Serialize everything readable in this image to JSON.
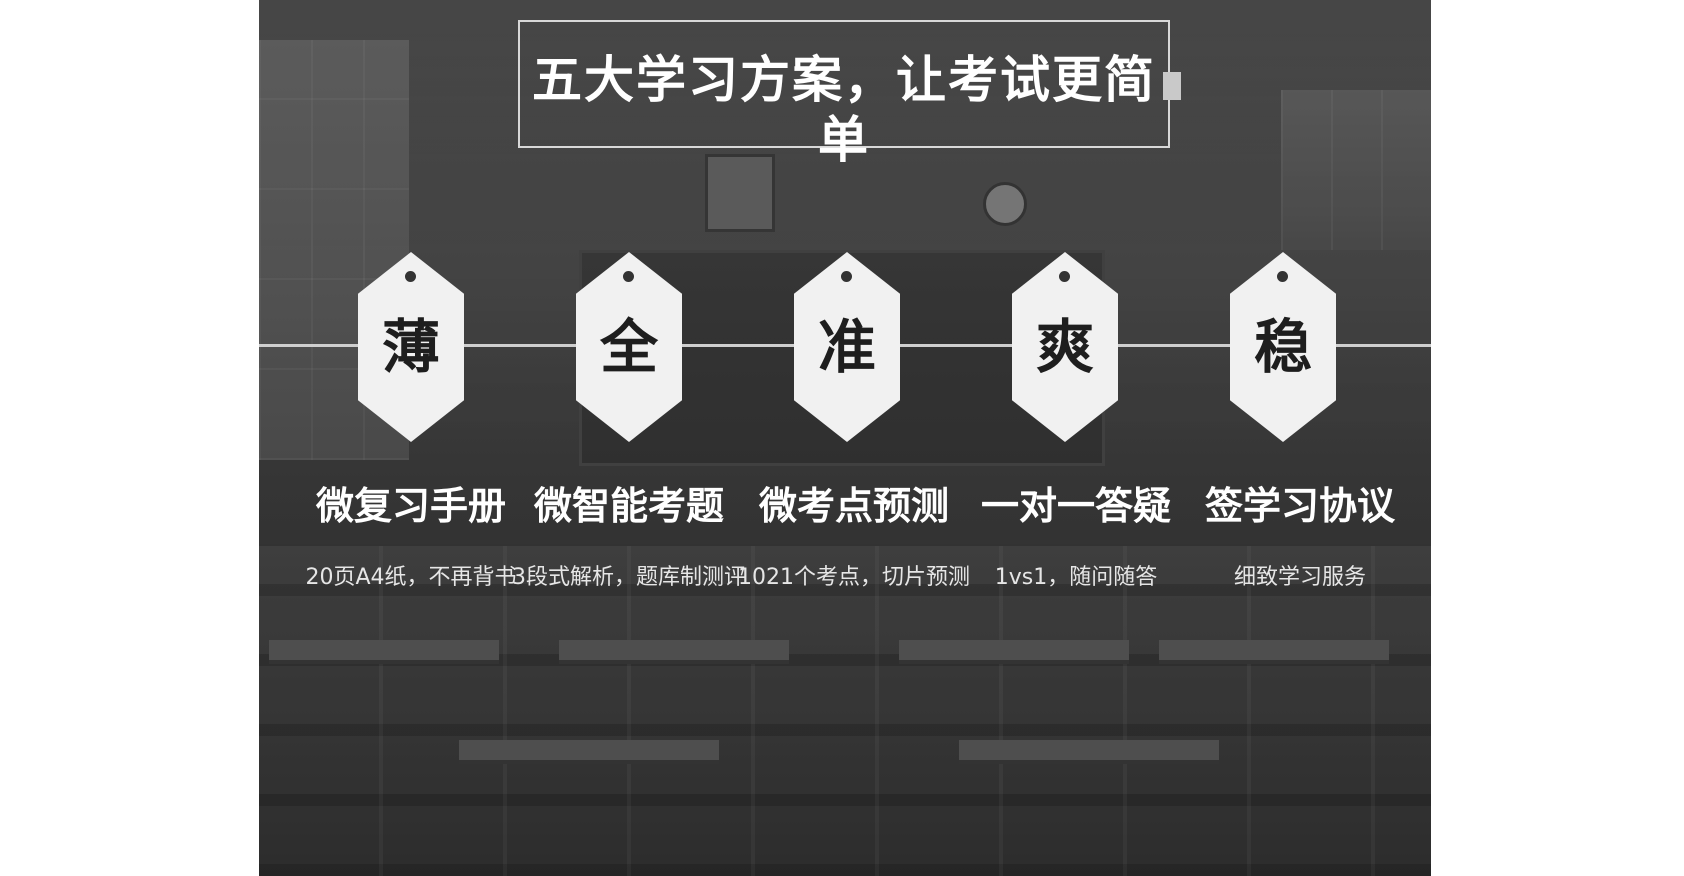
{
  "title": "五大学习方案，让考试更简单",
  "items": [
    {
      "char": "薄",
      "title": "微复习手册",
      "desc": "20页A4纸，不再背书"
    },
    {
      "char": "全",
      "title": "微智能考题",
      "desc": "3段式解析，题库制测评"
    },
    {
      "char": "准",
      "title": "微考点预测",
      "desc": "1021个考点，切片预测"
    },
    {
      "char": "爽",
      "title": "一对一答疑",
      "desc": "1vs1，随问随答"
    },
    {
      "char": "稳",
      "title": "签学习协议",
      "desc": "细致学习服务"
    }
  ],
  "colors": {
    "background": "#444444",
    "hexagon": "#f1f1f1",
    "text_light": "#ffffff"
  }
}
